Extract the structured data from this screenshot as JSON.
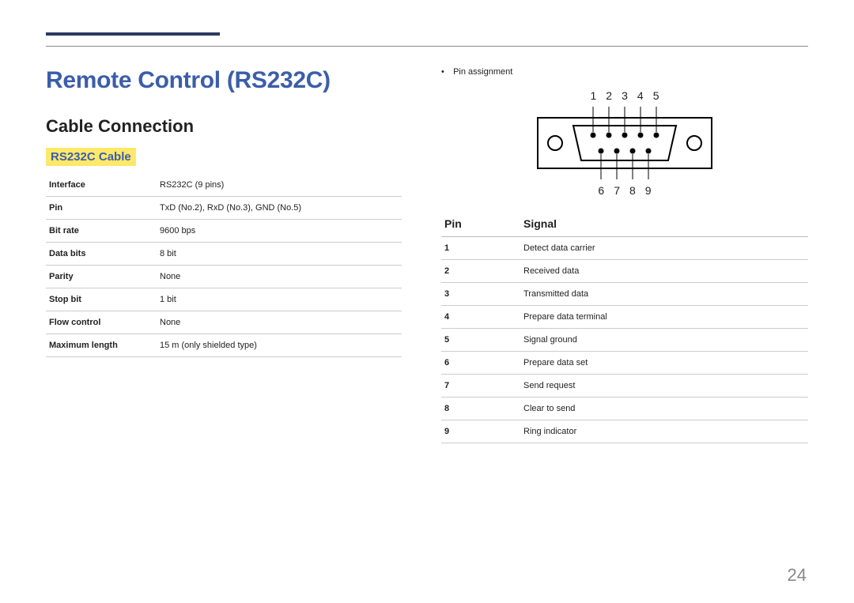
{
  "header": {
    "title": "Remote Control (RS232C)",
    "subtitle": "Cable Connection",
    "highlight": "RS232C Cable"
  },
  "spec": {
    "rows": [
      {
        "label": "Interface",
        "value": "RS232C (9 pins)"
      },
      {
        "label": "Pin",
        "value": "TxD (No.2), RxD (No.3), GND (No.5)"
      },
      {
        "label": "Bit rate",
        "value": "9600 bps"
      },
      {
        "label": "Data bits",
        "value": "8 bit"
      },
      {
        "label": "Parity",
        "value": "None"
      },
      {
        "label": "Stop bit",
        "value": "1 bit"
      },
      {
        "label": "Flow control",
        "value": "None"
      },
      {
        "label": "Maximum length",
        "value": "15 m (only shielded type)"
      }
    ]
  },
  "right": {
    "bullet": "Pin assignment",
    "top_pins": [
      "1",
      "2",
      "3",
      "4",
      "5"
    ],
    "bottom_pins": [
      "6",
      "7",
      "8",
      "9"
    ]
  },
  "pin_table": {
    "col1": "Pin",
    "col2": "Signal",
    "rows": [
      {
        "pin": "1",
        "signal": "Detect data carrier"
      },
      {
        "pin": "2",
        "signal": "Received data"
      },
      {
        "pin": "3",
        "signal": "Transmitted data"
      },
      {
        "pin": "4",
        "signal": "Prepare data terminal"
      },
      {
        "pin": "5",
        "signal": "Signal ground"
      },
      {
        "pin": "6",
        "signal": "Prepare data set"
      },
      {
        "pin": "7",
        "signal": "Send request"
      },
      {
        "pin": "8",
        "signal": "Clear to send"
      },
      {
        "pin": "9",
        "signal": "Ring indicator"
      }
    ]
  },
  "page_number": "24"
}
